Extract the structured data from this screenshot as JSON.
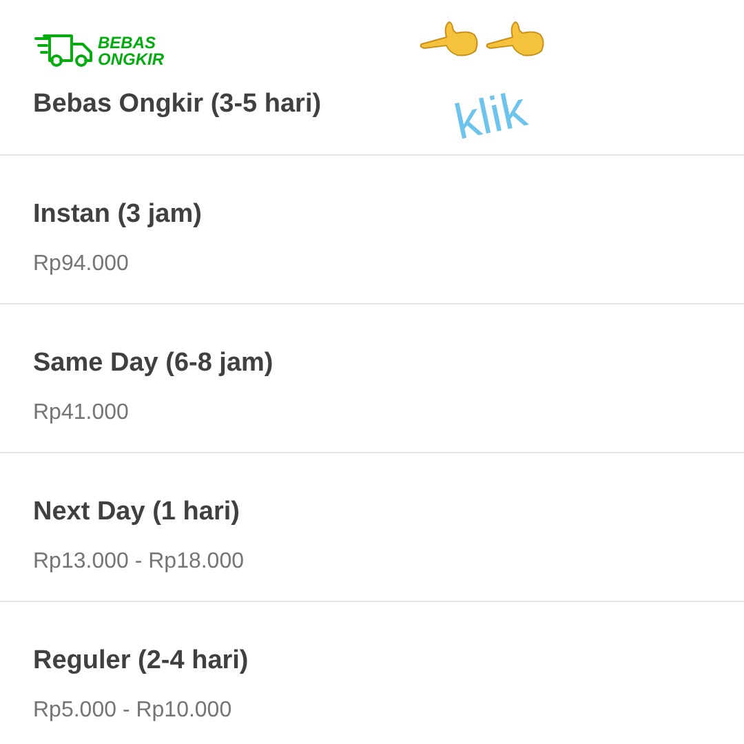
{
  "free_shipping": {
    "badge_lines": [
      "BEBAS",
      "ONGKIR"
    ],
    "name": "Bebas Ongkir (3-5 hari)"
  },
  "annotation": {
    "text": "klik"
  },
  "options": [
    {
      "name": "Instan (3 jam)",
      "price": "Rp94.000"
    },
    {
      "name": "Same Day (6-8 jam)",
      "price": "Rp41.000"
    },
    {
      "name": "Next Day (1 hari)",
      "price": "Rp13.000 - Rp18.000"
    },
    {
      "name": "Reguler (2-4 hari)",
      "price": "Rp5.000 - Rp10.000"
    }
  ]
}
